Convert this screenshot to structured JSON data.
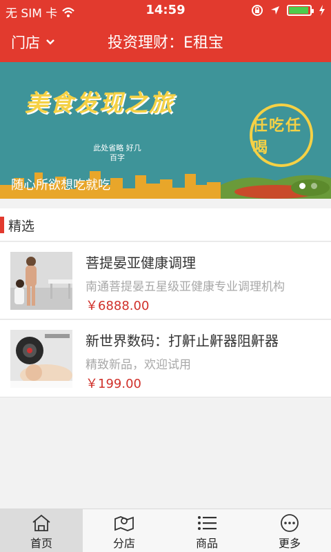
{
  "statusbar": {
    "carrier": "无 SIM 卡",
    "time": "14:59"
  },
  "navbar": {
    "store_label": "门店",
    "title": "投资理财：E租宝"
  },
  "banner": {
    "title": "美食发现之旅",
    "small_text": "此处省略 好几百字",
    "seal_text": "任吃任喝",
    "caption": "随心所欲想吃就吃"
  },
  "section": {
    "label": "精选"
  },
  "products": [
    {
      "name": "菩提晏亚健康调理",
      "desc": "南通菩提晏五星级亚健康专业调理机构",
      "price": "￥6888.00"
    },
    {
      "name": "新世界数码：打鼾止鼾器阻鼾器",
      "desc": "精致新品，欢迎试用",
      "price": "￥199.00"
    }
  ],
  "tabs": [
    {
      "label": "首页",
      "icon": "home-icon"
    },
    {
      "label": "分店",
      "icon": "map-icon"
    },
    {
      "label": "商品",
      "icon": "list-icon"
    },
    {
      "label": "更多",
      "icon": "more-icon"
    }
  ],
  "colors": {
    "primary": "#e23a2e",
    "price": "#d0302a",
    "banner_bg": "#3e9499"
  }
}
